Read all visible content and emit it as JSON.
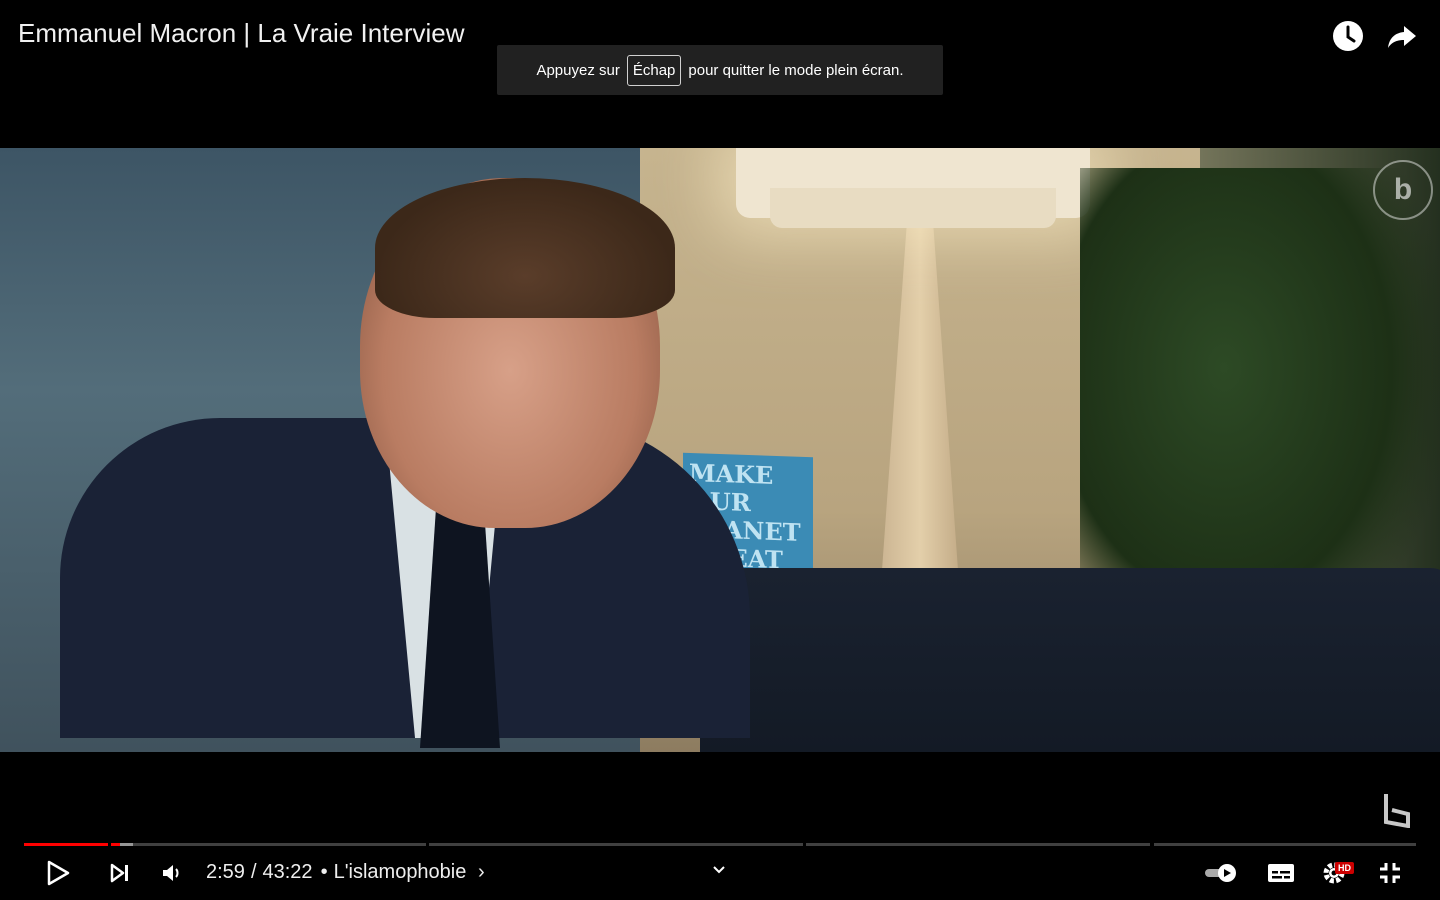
{
  "header": {
    "title": "Emmanuel Macron | La Vraie Interview",
    "watch_later_icon": "clock-icon",
    "share_icon": "share-icon"
  },
  "fullscreen_hint": {
    "before": "Appuyez sur",
    "key": "Échap",
    "after": "pour quitter le mode plein écran."
  },
  "video": {
    "book_text": "MAKE OUR PLANET GREAT AGAIN",
    "watermark_icon": "channel-logo-icon"
  },
  "player": {
    "progress_played_fraction": 0.069,
    "colors": {
      "played": "#ff0000",
      "background": "#000000",
      "hd_badge": "#cc0000"
    },
    "current_time": "2:59",
    "time_separator": "/",
    "duration": "43:22",
    "chapter_bullet": "•",
    "chapter": "L'islamophobie",
    "chapter_chevron": "›",
    "icons": {
      "play": "play-icon",
      "next": "next-icon",
      "volume": "volume-icon",
      "chevron": "chevron-down-icon",
      "autoplay": "autoplay-toggle-icon",
      "subtitles": "subtitles-icon",
      "settings": "settings-icon",
      "exit_fullscreen": "exit-fullscreen-icon"
    },
    "hd_label": "HD"
  }
}
